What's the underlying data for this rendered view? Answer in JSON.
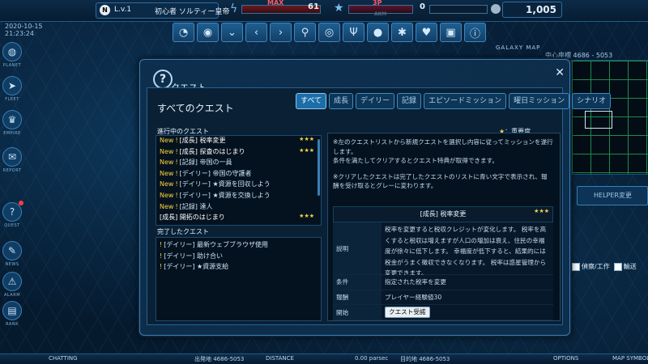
{
  "header": {
    "player_badge": "N",
    "level_text": "L.v.1",
    "player_name": "初心者 ソルティー皇帝",
    "hp_label": "MAX",
    "hp_value": "61",
    "ap_label": "3P",
    "ap_sub": "AKM",
    "ap_value": "0",
    "credits": "1,005"
  },
  "toolbar_icons": [
    "chat-icon",
    "planet-icon",
    "chevron-down-icon",
    "chevron-left-icon",
    "chevron-right-icon",
    "search-icon",
    "ring-icon",
    "trident-icon",
    "galaxy-icon",
    "bug-icon",
    "heart-icon",
    "image-icon",
    "info-icon"
  ],
  "sidebar": {
    "clock": [
      "2020-10-15",
      "21:23:24"
    ],
    "items": [
      {
        "label": "PLANET",
        "icon": "planet-icon"
      },
      {
        "label": "FLEET",
        "icon": "ship-icon"
      },
      {
        "label": "EMPIRE",
        "icon": "empire-icon"
      },
      {
        "label": "REPORT",
        "icon": "report-icon"
      },
      {
        "label": "QUEST",
        "icon": "quest-icon"
      },
      {
        "label": "NEWS",
        "icon": "news-icon"
      },
      {
        "label": "ALARM",
        "icon": "alarm-icon"
      },
      {
        "label": "RANK",
        "icon": "rank-icon"
      }
    ]
  },
  "map": {
    "galaxy_map_label": "GALAXY MAP",
    "center_coords": "中心座標 4686 - 5053",
    "helper_button": "HELPER変更",
    "check1": "偵察/工作",
    "check2": "輸送"
  },
  "bottom": {
    "chatting": "CHATTING",
    "origin": "出発地 4686-5053",
    "distance": "DISTANCE",
    "parsec": "0.00 parsec",
    "dest": "目的地 4686-5053",
    "options": "OPTIONS",
    "mapsymbol": "MAP SYMBOL"
  },
  "dialog": {
    "title": "クエスト",
    "all_quests": "すべてのクエスト",
    "tabs": [
      "すべて",
      "成長",
      "デイリー",
      "記録",
      "エピソードミッション",
      "曜日ミッション",
      "シナリオ"
    ],
    "active_tab": 0,
    "in_progress_label": "進行中のクエスト",
    "completed_label": "完了したクエスト",
    "legend": "：重要度",
    "legend_star": "★",
    "in_progress": [
      {
        "new": "New",
        "text": "[成長] 税率変更",
        "stars": "★★★",
        "highlight": true
      },
      {
        "new": "New",
        "text": "[成長] 探査のはじまり",
        "stars": "★★★",
        "highlight": true
      },
      {
        "new": "New",
        "text": "[記録] 帝国の一員",
        "stars": ""
      },
      {
        "new": "New",
        "text": "[デイリー] 帝国の守護者",
        "stars": ""
      },
      {
        "new": "New",
        "text": "[デイリー] ★資源を回収しよう",
        "stars": ""
      },
      {
        "new": "New",
        "text": "[デイリー] ★資源を交換しよう",
        "stars": ""
      },
      {
        "new": "New",
        "text": "[記録] 達人",
        "stars": ""
      },
      {
        "new": "",
        "text": "[成長] 開拓のはじまり",
        "stars": "★★★",
        "highlight": true
      }
    ],
    "completed": [
      {
        "text": "[デイリー] 最新ウェブブラウザ使用"
      },
      {
        "text": "[デイリー] 助け合い"
      },
      {
        "text": "[デイリー] ★資源支給"
      }
    ],
    "description": [
      "※左のクエストリストから新規クエストを選択し内容に従ってミッションを遂行します。",
      "条件を満たしてクリアするとクエスト特典が取得できます。",
      "",
      "※クリアしたクエストは完了したクエストのリストに青い文字で表示され、報酬を受け取るとグレーに変わります。"
    ],
    "detail": {
      "title": "[成長] 税率変更",
      "stars": "★★★",
      "desc_label": "説明",
      "desc_text": "税率を変更すると税収クレジットが変化します。 税率を高くすると税収は増えますが人口の増加は衰え、住民の幸福度が徐々に低下します。 幸福度が低下すると、結果的には税金がうまく徴収できなくなります。 税率は惑星管理から変更できます。",
      "cond_label": "条件",
      "cond_text": "指定された税率を変更",
      "reward_label": "報酬",
      "reward_text": "プレイヤー経験値30",
      "start_label": "開始",
      "accept_button": "クエスト受諾"
    }
  }
}
